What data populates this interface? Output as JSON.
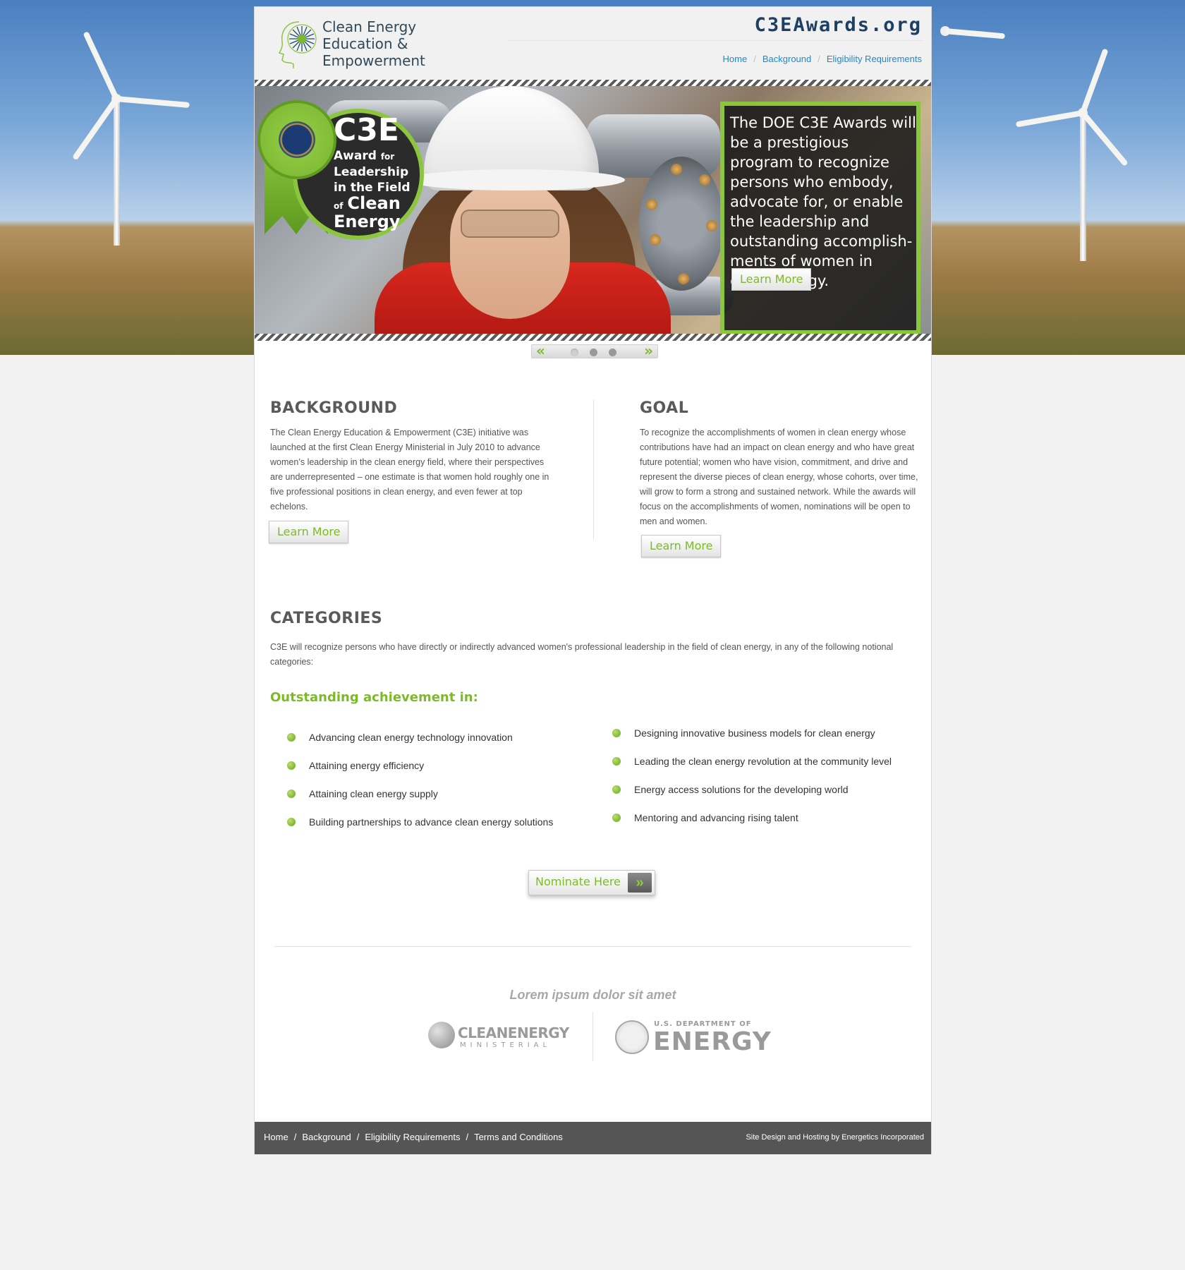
{
  "header": {
    "logo_lines": [
      "Clean Energy",
      "Education &",
      "Empowerment"
    ],
    "site_domain": "C3EAwards.org",
    "nav": [
      "Home",
      "Background",
      "Eligibility Requirements"
    ]
  },
  "hero": {
    "award": {
      "title": "C3E",
      "line1": "Award",
      "line1_small": "for",
      "line2": "Leadership",
      "line3": "in the Field",
      "line4_small": "of",
      "line4": "Clean",
      "line5": "Energy"
    },
    "callout_text": "The DOE C3E Awards will be a prestigious program to recognize persons who embody, advocate for, or enable the leadership and outstanding accomplish-ments of women in clean energy.",
    "learn_more": "Learn More"
  },
  "slider_nav": {
    "prev": "«",
    "next": "»",
    "dots": 3,
    "active_dot": 1
  },
  "background": {
    "title": "BACKGROUND",
    "text": "The Clean Energy Education & Empowerment (C3E) initiative was launched at the first Clean Energy Ministerial in July 2010 to advance women’s leadership in the clean energy field, where their perspectives are underrepresented – one estimate is that women hold roughly one in five professional positions in clean energy, and even fewer at top echelons.",
    "button": "Learn More"
  },
  "goal": {
    "title": "GOAL",
    "text": "To recognize the accomplishments of women in clean energy whose contributions have had an impact on clean energy and who have great future potential; women who have vision, commitment, and drive and represent the diverse pieces of clean energy, whose cohorts, over time, will grow to form a strong and sustained network. While the awards will focus on the accomplishments of women, nominations will be open to men and women.",
    "button": "Learn More"
  },
  "categories": {
    "title": "CATEGORIES",
    "intro": "C3E will recognize persons who have directly or indirectly advanced women's professional leadership in the field of clean energy, in any of the following notional categories:",
    "subtitle": "Outstanding achievement in:",
    "left": [
      "Advancing clean energy technology innovation",
      "Attaining energy efficiency",
      "Attaining clean energy supply",
      "Building partnerships to advance clean energy solutions"
    ],
    "right": [
      "Designing innovative business models for clean energy",
      "Leading the clean energy revolution at the community level",
      "Energy access solutions for the developing world",
      "Mentoring and advancing rising talent"
    ]
  },
  "nominate": {
    "label": "Nominate Here",
    "arrow": "»"
  },
  "partners": {
    "title": "Lorem ipsum dolor sit amet",
    "cem_name": "CLEANENERGY",
    "cem_sub": "MINISTERIAL",
    "doe_sub": "U.S. DEPARTMENT OF",
    "doe_name": "ENERGY"
  },
  "footer": {
    "nav": [
      "Home",
      "Background",
      "Eligibility Requirements",
      "Terms and Conditions"
    ],
    "credit": "Site Design and Hosting by Energetics Incorporated"
  },
  "colors": {
    "accent_green": "#7dba2a",
    "link_blue": "#1a8ad0",
    "footer_gray": "#555555",
    "domain_navy": "#1d3f62"
  }
}
